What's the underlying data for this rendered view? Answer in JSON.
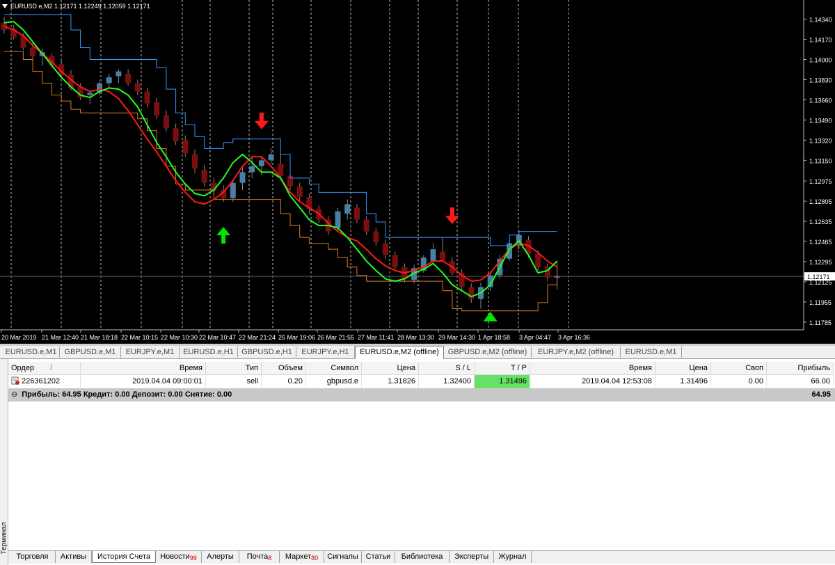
{
  "chart": {
    "symbol_label": "EURUSD.e,M2",
    "ohlc_label": "1.12171 1.12249 1.12059 1.12171",
    "price_ticks": [
      "1.14340",
      "1.14170",
      "1.14000",
      "1.13830",
      "1.13660",
      "1.13490",
      "1.13320",
      "1.13150",
      "1.12975",
      "1.12805",
      "1.12635",
      "1.12465",
      "1.12295",
      "1.12125",
      "1.11955",
      "1.11785"
    ],
    "current_price": "1.12171",
    "time_ticks": [
      "20 Mar 2019",
      "21 Mar 12:40",
      "21 Mar 18:18",
      "22 Mar 10:15",
      "22 Mar 10:30",
      "22 Mar 10:47",
      "22 Mar 21:24",
      "25 Mar 19:06",
      "26 Mar 21:55",
      "27 Mar 11:41",
      "28 Mar 13:30",
      "29 Mar 14:30",
      "1 Apr 18:58",
      "3 Apr 04:47",
      "3 Apr 16:36"
    ],
    "colors": {
      "bull": "#4a7ea3",
      "bear": "#7b0f0f",
      "red_line": "#ff1a1a",
      "green_line": "#22ff22",
      "blue_line": "#3399ff",
      "orange_line": "#e07a20",
      "arrow_down": "#ff1a1a",
      "arrow_up": "#00e600"
    },
    "series": {
      "red": [
        1.1428,
        1.1425,
        1.142,
        1.1412,
        1.1405,
        1.1398,
        1.139,
        1.1383,
        1.1377,
        1.1373,
        1.1375,
        1.1373,
        1.1367,
        1.1357,
        1.1345,
        1.1333,
        1.1322,
        1.131,
        1.1298,
        1.1288,
        1.128,
        1.1278,
        1.1282,
        1.1288,
        1.1298,
        1.131,
        1.1318,
        1.1318,
        1.131,
        1.13,
        1.1288,
        1.128,
        1.1275,
        1.127,
        1.1262,
        1.1255,
        1.125,
        1.1247,
        1.124,
        1.1232,
        1.1226,
        1.1222,
        1.122,
        1.1222,
        1.1225,
        1.123,
        1.123,
        1.1225,
        1.1218,
        1.1213,
        1.1214,
        1.122,
        1.123,
        1.124,
        1.1245,
        1.1243,
        1.1237,
        1.123,
        1.1225
      ],
      "green": [
        1.1431,
        1.1432,
        1.1425,
        1.1415,
        1.1405,
        1.1395,
        1.1385,
        1.1377,
        1.137,
        1.1368,
        1.1373,
        1.1376,
        1.1375,
        1.137,
        1.136,
        1.1345,
        1.133,
        1.1318,
        1.1305,
        1.1295,
        1.1287,
        1.1285,
        1.129,
        1.13,
        1.1313,
        1.132,
        1.1313,
        1.1305,
        1.1305,
        1.13,
        1.1285,
        1.1275,
        1.1265,
        1.126,
        1.126,
        1.1258,
        1.125,
        1.124,
        1.123,
        1.1222,
        1.1215,
        1.1213,
        1.1215,
        1.122,
        1.1223,
        1.1228,
        1.122,
        1.121,
        1.1205,
        1.12,
        1.1203,
        1.121,
        1.1225,
        1.124,
        1.1247,
        1.1235,
        1.122,
        1.1222,
        1.123
      ],
      "blue": [
        1.1438,
        1.1438,
        1.1438,
        1.1438,
        1.1438,
        1.1438,
        1.1438,
        1.1425,
        1.141,
        1.14,
        1.14,
        1.14,
        1.14,
        1.14,
        1.14,
        1.14,
        1.1393,
        1.1375,
        1.1355,
        1.1345,
        1.1335,
        1.1325,
        1.1325,
        1.133,
        1.1333,
        1.1333,
        1.1333,
        1.1333,
        1.1333,
        1.132,
        1.13,
        1.13,
        1.1295,
        1.1288,
        1.1288,
        1.1288,
        1.1288,
        1.1288,
        1.127,
        1.1263,
        1.125,
        1.125,
        1.125,
        1.125,
        1.125,
        1.125,
        1.125,
        1.125,
        1.125,
        1.125,
        1.125,
        1.1243,
        1.1243,
        1.1252,
        1.1255,
        1.1255,
        1.1255,
        1.1255,
        1.1255
      ],
      "orange": [
        1.1407,
        1.1407,
        1.14,
        1.139,
        1.138,
        1.137,
        1.1365,
        1.1358,
        1.1355,
        1.1355,
        1.1355,
        1.1355,
        1.1355,
        1.1355,
        1.135,
        1.134,
        1.1325,
        1.131,
        1.1295,
        1.129,
        1.129,
        1.129,
        1.1282,
        1.1282,
        1.1282,
        1.1282,
        1.1282,
        1.1282,
        1.1282,
        1.127,
        1.126,
        1.125,
        1.1245,
        1.1245,
        1.124,
        1.1233,
        1.1225,
        1.1218,
        1.1213,
        1.1213,
        1.1213,
        1.1213,
        1.1213,
        1.1213,
        1.1213,
        1.1213,
        1.1205,
        1.119,
        1.1188,
        1.1188,
        1.1188,
        1.1188,
        1.1188,
        1.1188,
        1.1188,
        1.1188,
        1.1195,
        1.121,
        1.123
      ],
      "candles": [
        [
          1.1431,
          1.1436,
          1.1422,
          1.1425
        ],
        [
          1.1426,
          1.1429,
          1.1417,
          1.1419
        ],
        [
          1.142,
          1.1422,
          1.1408,
          1.141
        ],
        [
          1.141,
          1.1414,
          1.14,
          1.1403
        ],
        [
          1.1403,
          1.1409,
          1.1395,
          1.1406
        ],
        [
          1.1403,
          1.1405,
          1.1393,
          1.1395
        ],
        [
          1.1396,
          1.1399,
          1.1385,
          1.1387
        ],
        [
          1.1387,
          1.1391,
          1.1374,
          1.1376
        ],
        [
          1.1377,
          1.138,
          1.1366,
          1.1368
        ],
        [
          1.137,
          1.1373,
          1.1362,
          1.1372
        ],
        [
          1.1372,
          1.1382,
          1.137,
          1.138
        ],
        [
          1.138,
          1.1388,
          1.1376,
          1.1385
        ],
        [
          1.1386,
          1.1392,
          1.138,
          1.139
        ],
        [
          1.1388,
          1.1392,
          1.1378,
          1.138
        ],
        [
          1.138,
          1.1383,
          1.137,
          1.1373
        ],
        [
          1.1373,
          1.1376,
          1.136,
          1.1363
        ],
        [
          1.1364,
          1.1368,
          1.135,
          1.1353
        ],
        [
          1.1353,
          1.1357,
          1.1339,
          1.1342
        ],
        [
          1.1342,
          1.1346,
          1.1328,
          1.1331
        ],
        [
          1.1332,
          1.1336,
          1.1318,
          1.1321
        ],
        [
          1.132,
          1.1324,
          1.1304,
          1.1308
        ],
        [
          1.1307,
          1.1311,
          1.1293,
          1.1296
        ],
        [
          1.1296,
          1.13,
          1.1286,
          1.1289
        ],
        [
          1.129,
          1.1294,
          1.128,
          1.1283
        ],
        [
          1.1283,
          1.1298,
          1.128,
          1.1296
        ],
        [
          1.1296,
          1.131,
          1.129,
          1.1305
        ],
        [
          1.1305,
          1.1318,
          1.13,
          1.131
        ],
        [
          1.131,
          1.1318,
          1.1303,
          1.1315
        ],
        [
          1.1315,
          1.1325,
          1.1312,
          1.132
        ],
        [
          1.1312,
          1.132,
          1.1298,
          1.1302
        ],
        [
          1.1302,
          1.1306,
          1.129,
          1.1293
        ],
        [
          1.1293,
          1.1296,
          1.128,
          1.1284
        ],
        [
          1.1284,
          1.1287,
          1.127,
          1.1274
        ],
        [
          1.1274,
          1.1277,
          1.1262,
          1.1265
        ],
        [
          1.1265,
          1.1268,
          1.1252,
          1.1255
        ],
        [
          1.1258,
          1.1275,
          1.1255,
          1.1272
        ],
        [
          1.127,
          1.1282,
          1.1265,
          1.1278
        ],
        [
          1.1275,
          1.1278,
          1.1262,
          1.1265
        ],
        [
          1.1265,
          1.1268,
          1.1252,
          1.1255
        ],
        [
          1.1255,
          1.1258,
          1.1243,
          1.1246
        ],
        [
          1.1245,
          1.1248,
          1.1232,
          1.1235
        ],
        [
          1.1235,
          1.1238,
          1.1222,
          1.1225
        ],
        [
          1.1225,
          1.1228,
          1.1212,
          1.1215
        ],
        [
          1.1214,
          1.1227,
          1.1211,
          1.1224
        ],
        [
          1.1222,
          1.1235,
          1.122,
          1.1233
        ],
        [
          1.123,
          1.1245,
          1.1228,
          1.124
        ],
        [
          1.1238,
          1.125,
          1.1234,
          1.123
        ],
        [
          1.123,
          1.1233,
          1.1218,
          1.122
        ],
        [
          1.122,
          1.1223,
          1.1205,
          1.1208
        ],
        [
          1.1208,
          1.1211,
          1.1195,
          1.1198
        ],
        [
          1.1198,
          1.1212,
          1.119,
          1.1208
        ],
        [
          1.1208,
          1.122,
          1.1205,
          1.1218
        ],
        [
          1.1218,
          1.1235,
          1.1215,
          1.1232
        ],
        [
          1.1232,
          1.1248,
          1.123,
          1.1245
        ],
        [
          1.1243,
          1.1255,
          1.124,
          1.1252
        ],
        [
          1.1248,
          1.1251,
          1.1233,
          1.1236
        ],
        [
          1.1236,
          1.1239,
          1.1222,
          1.1225
        ],
        [
          1.1225,
          1.1228,
          1.1213,
          1.1216
        ],
        [
          1.1216,
          1.1225,
          1.1206,
          1.1217
        ]
      ]
    },
    "markers": [
      {
        "type": "down",
        "index": 27,
        "price": 1.134
      },
      {
        "type": "up",
        "index": 23,
        "price": 1.126
      },
      {
        "type": "down",
        "index": 47,
        "price": 1.126
      },
      {
        "type": "up",
        "index": 51,
        "price": 1.1185
      }
    ],
    "price_min": 1.1172,
    "price_max": 1.1442
  },
  "chart_tabs": [
    "EURUSD.e,M1",
    "GBPUSD.e,M1",
    "EURJPY.e,M1",
    "EURUSD.e,H1",
    "GBPUSD.e,H1",
    "EURJPY.e,H1",
    "EURUSD.e,M2 (offline)",
    "GBPUSD.e,M2 (offline)",
    "EURJPY.e,M2 (offline)",
    "EURUSD.e,M1"
  ],
  "active_chart_tab": 6,
  "terminal": {
    "side_label": "Терминал",
    "headers": [
      "Ордер",
      "/",
      "Время",
      "Тип",
      "Объем",
      "Символ",
      "Цена",
      "S / L",
      "T / P",
      "Время",
      "Цена",
      "Своп",
      "Прибыль"
    ],
    "row": {
      "order": "226361202",
      "time": "2019.04.04 09:00:01",
      "type": "sell",
      "volume": "0.20",
      "symbol": "gbpusd.e",
      "price": "1.31826",
      "sl": "1.32400",
      "tp": "1.31496",
      "close_time": "2019.04.04 12:53:08",
      "close_price": "1.31496",
      "swap": "0.00",
      "profit": "66.00"
    },
    "summary": "Прибыль: 64.95  Кредит: 0.00  Депозит: 0.00  Снятие: 0.00",
    "summary_total": "64.95",
    "tp_highlight": "#66e066"
  },
  "bottom_tabs": [
    {
      "label": "Торговля",
      "badge": ""
    },
    {
      "label": "Активы",
      "badge": ""
    },
    {
      "label": "История Счета",
      "badge": ""
    },
    {
      "label": "Новости",
      "badge": "99"
    },
    {
      "label": "Алерты",
      "badge": ""
    },
    {
      "label": "Почта",
      "badge": "8"
    },
    {
      "label": "Маркет",
      "badge": "80"
    },
    {
      "label": "Сигналы",
      "badge": ""
    },
    {
      "label": "Статьи",
      "badge": ""
    },
    {
      "label": "Библиотека",
      "badge": ""
    },
    {
      "label": "Эксперты",
      "badge": ""
    },
    {
      "label": "Журнал",
      "badge": ""
    }
  ],
  "active_bottom_tab": 2
}
